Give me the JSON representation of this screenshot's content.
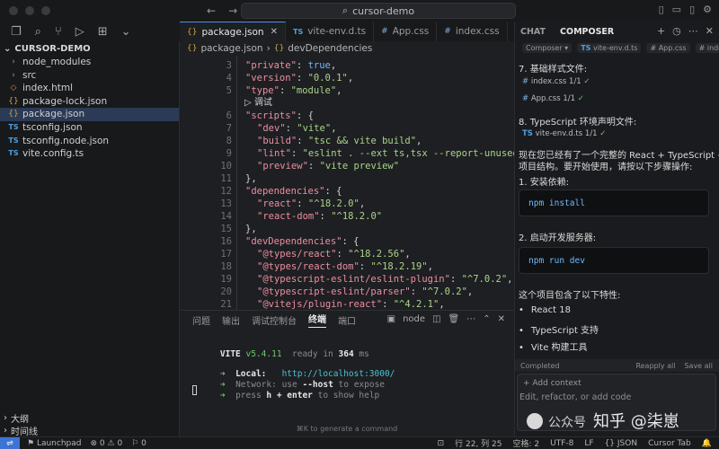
{
  "titlebar": {
    "search_text": "cursor-demo"
  },
  "explorer": {
    "root": "CURSOR-DEMO",
    "items": [
      {
        "label": "node_modules",
        "icon": "chevron-right-icon",
        "kind": "folder"
      },
      {
        "label": "src",
        "icon": "chevron-right-icon",
        "kind": "folder"
      },
      {
        "label": "index.html",
        "icon": "html-file-icon",
        "kind": "html"
      },
      {
        "label": "package-lock.json",
        "icon": "json-file-icon",
        "kind": "json"
      },
      {
        "label": "package.json",
        "icon": "json-file-icon",
        "kind": "json",
        "active": true
      },
      {
        "label": "tsconfig.json",
        "icon": "ts-file-icon",
        "kind": "ts"
      },
      {
        "label": "tsconfig.node.json",
        "icon": "ts-file-icon",
        "kind": "ts"
      },
      {
        "label": "vite.config.ts",
        "icon": "ts-file-icon",
        "kind": "ts"
      }
    ],
    "outline_label": "大纲",
    "timeline_label": "时间线"
  },
  "tabs": [
    {
      "label": "package.json",
      "active": true,
      "icon": "json"
    },
    {
      "label": "vite-env.d.ts",
      "icon": "ts"
    },
    {
      "label": "App.css",
      "icon": "css"
    },
    {
      "label": "index.css",
      "icon": "css"
    }
  ],
  "breadcrumb": {
    "file": "package.json",
    "sep": "›",
    "symbol": "devDependencies"
  },
  "code": {
    "codelens": "调试",
    "lines": [
      {
        "n": "3",
        "indent": 1,
        "key": "\"private\"",
        "val": "true",
        "type": "kw",
        "tail": ","
      },
      {
        "n": "4",
        "indent": 1,
        "key": "\"version\"",
        "val": "\"0.0.1\"",
        "type": "s",
        "tail": ","
      },
      {
        "n": "5",
        "indent": 1,
        "key": "\"type\"",
        "val": "\"module\"",
        "type": "s",
        "tail": ","
      },
      {
        "n": "6",
        "indent": 1,
        "key": "\"scripts\"",
        "val": "{",
        "type": "p",
        "tail": ""
      },
      {
        "n": "7",
        "indent": 2,
        "key": "\"dev\"",
        "val": "\"vite\"",
        "type": "s",
        "tail": ","
      },
      {
        "n": "8",
        "indent": 2,
        "key": "\"build\"",
        "val": "\"tsc && vite build\"",
        "type": "s",
        "tail": ","
      },
      {
        "n": "9",
        "indent": 2,
        "key": "\"lint\"",
        "val": "\"eslint . --ext ts,tsx --report-unused-disab",
        "type": "s",
        "tail": ""
      },
      {
        "n": "10",
        "indent": 2,
        "key": "\"preview\"",
        "val": "\"vite preview\"",
        "type": "s",
        "tail": ""
      },
      {
        "n": "11",
        "indent": 1,
        "key": "",
        "val": "},",
        "type": "p",
        "tail": ""
      },
      {
        "n": "12",
        "indent": 1,
        "key": "\"dependencies\"",
        "val": "{",
        "type": "p",
        "tail": ""
      },
      {
        "n": "13",
        "indent": 2,
        "key": "\"react\"",
        "val": "\"^18.2.0\"",
        "type": "s",
        "tail": ","
      },
      {
        "n": "14",
        "indent": 2,
        "key": "\"react-dom\"",
        "val": "\"^18.2.0\"",
        "type": "s",
        "tail": ""
      },
      {
        "n": "15",
        "indent": 1,
        "key": "",
        "val": "},",
        "type": "p",
        "tail": ""
      },
      {
        "n": "16",
        "indent": 1,
        "key": "\"devDependencies\"",
        "val": "{",
        "type": "p",
        "tail": ""
      },
      {
        "n": "17",
        "indent": 2,
        "key": "\"@types/react\"",
        "val": "\"^18.2.56\"",
        "type": "s",
        "tail": ","
      },
      {
        "n": "18",
        "indent": 2,
        "key": "\"@types/react-dom\"",
        "val": "\"^18.2.19\"",
        "type": "s",
        "tail": ","
      },
      {
        "n": "19",
        "indent": 2,
        "key": "\"@typescript-eslint/eslint-plugin\"",
        "val": "\"^7.0.2\"",
        "type": "s",
        "tail": ","
      },
      {
        "n": "20",
        "indent": 2,
        "key": "\"@typescript-eslint/parser\"",
        "val": "\"^7.0.2\"",
        "type": "s",
        "tail": ","
      },
      {
        "n": "21",
        "indent": 2,
        "key": "\"@vitejs/plugin-react\"",
        "val": "\"^4.2.1\"",
        "type": "s",
        "tail": ","
      }
    ]
  },
  "panel": {
    "tabs": [
      "问题",
      "输出",
      "调试控制台",
      "终端",
      "端口"
    ],
    "active_tab": "终端",
    "shell": "node",
    "vite_name": "VITE",
    "vite_version": "v5.4.11",
    "ready_text": "ready in",
    "ready_ms": "364",
    "ready_unit": "ms",
    "arrow": "➜",
    "local_label": "Local:",
    "local_url": "http://localhost:3000/",
    "network_label": "Network:",
    "network_use": "use",
    "network_flag": "--host",
    "network_tail": "to expose",
    "help_press": "press",
    "help_key": "h + enter",
    "help_tail": "to show help",
    "hint": "⌘K to generate a command"
  },
  "composer": {
    "tabs": [
      "CHAT",
      "COMPOSER"
    ],
    "active_tab": "COMPOSER",
    "chips": {
      "composer": "Composer ▾",
      "ts_tag": "TS",
      "file1": "vite-env.d.ts",
      "file2": "App.css",
      "file3": "index"
    },
    "sec7": "7. 基础样式文件:",
    "ref_index": "index.css",
    "ref_app": "App.css",
    "ref_count": "1/1",
    "ok": "✓",
    "sec8": "8. TypeScript 环境声明文件:",
    "ref_env": "vite-env.d.ts",
    "summary1": "现在您已经有了一个完整的 React + TypeScript + Vite",
    "summary2": "项目结构。要开始使用，请按以下步骤操作:",
    "step1": "1. 安装依赖:",
    "cmd1": "npm install",
    "step2": "2. 启动开发服务器:",
    "cmd2": "npm run dev",
    "features_title": "这个项目包含了以下特性:",
    "features": [
      "React 18",
      "TypeScript 支持",
      "Vite 构建工具"
    ],
    "completed": "Completed",
    "reapply": "Reapply all",
    "save_all": "Save all",
    "add_context": "Add context",
    "input_placeholder": "Edit, refactor, or add code",
    "watermark": "知乎 @柒崽",
    "watermark_prefix": "公众号"
  },
  "statusbar": {
    "launchpad": "Launchpad",
    "errors": "0",
    "warnings": "0",
    "ports": "0",
    "position": "行 22, 列 25",
    "spaces": "空格: 2",
    "encoding": "UTF-8",
    "eol": "LF",
    "language": "JSON",
    "cursor_tab": "Cursor Tab"
  },
  "colors": {
    "accent": "#4a90e2",
    "string": "#a9d58a",
    "key": "#ec8ea1",
    "keyword": "#70b8ff"
  }
}
